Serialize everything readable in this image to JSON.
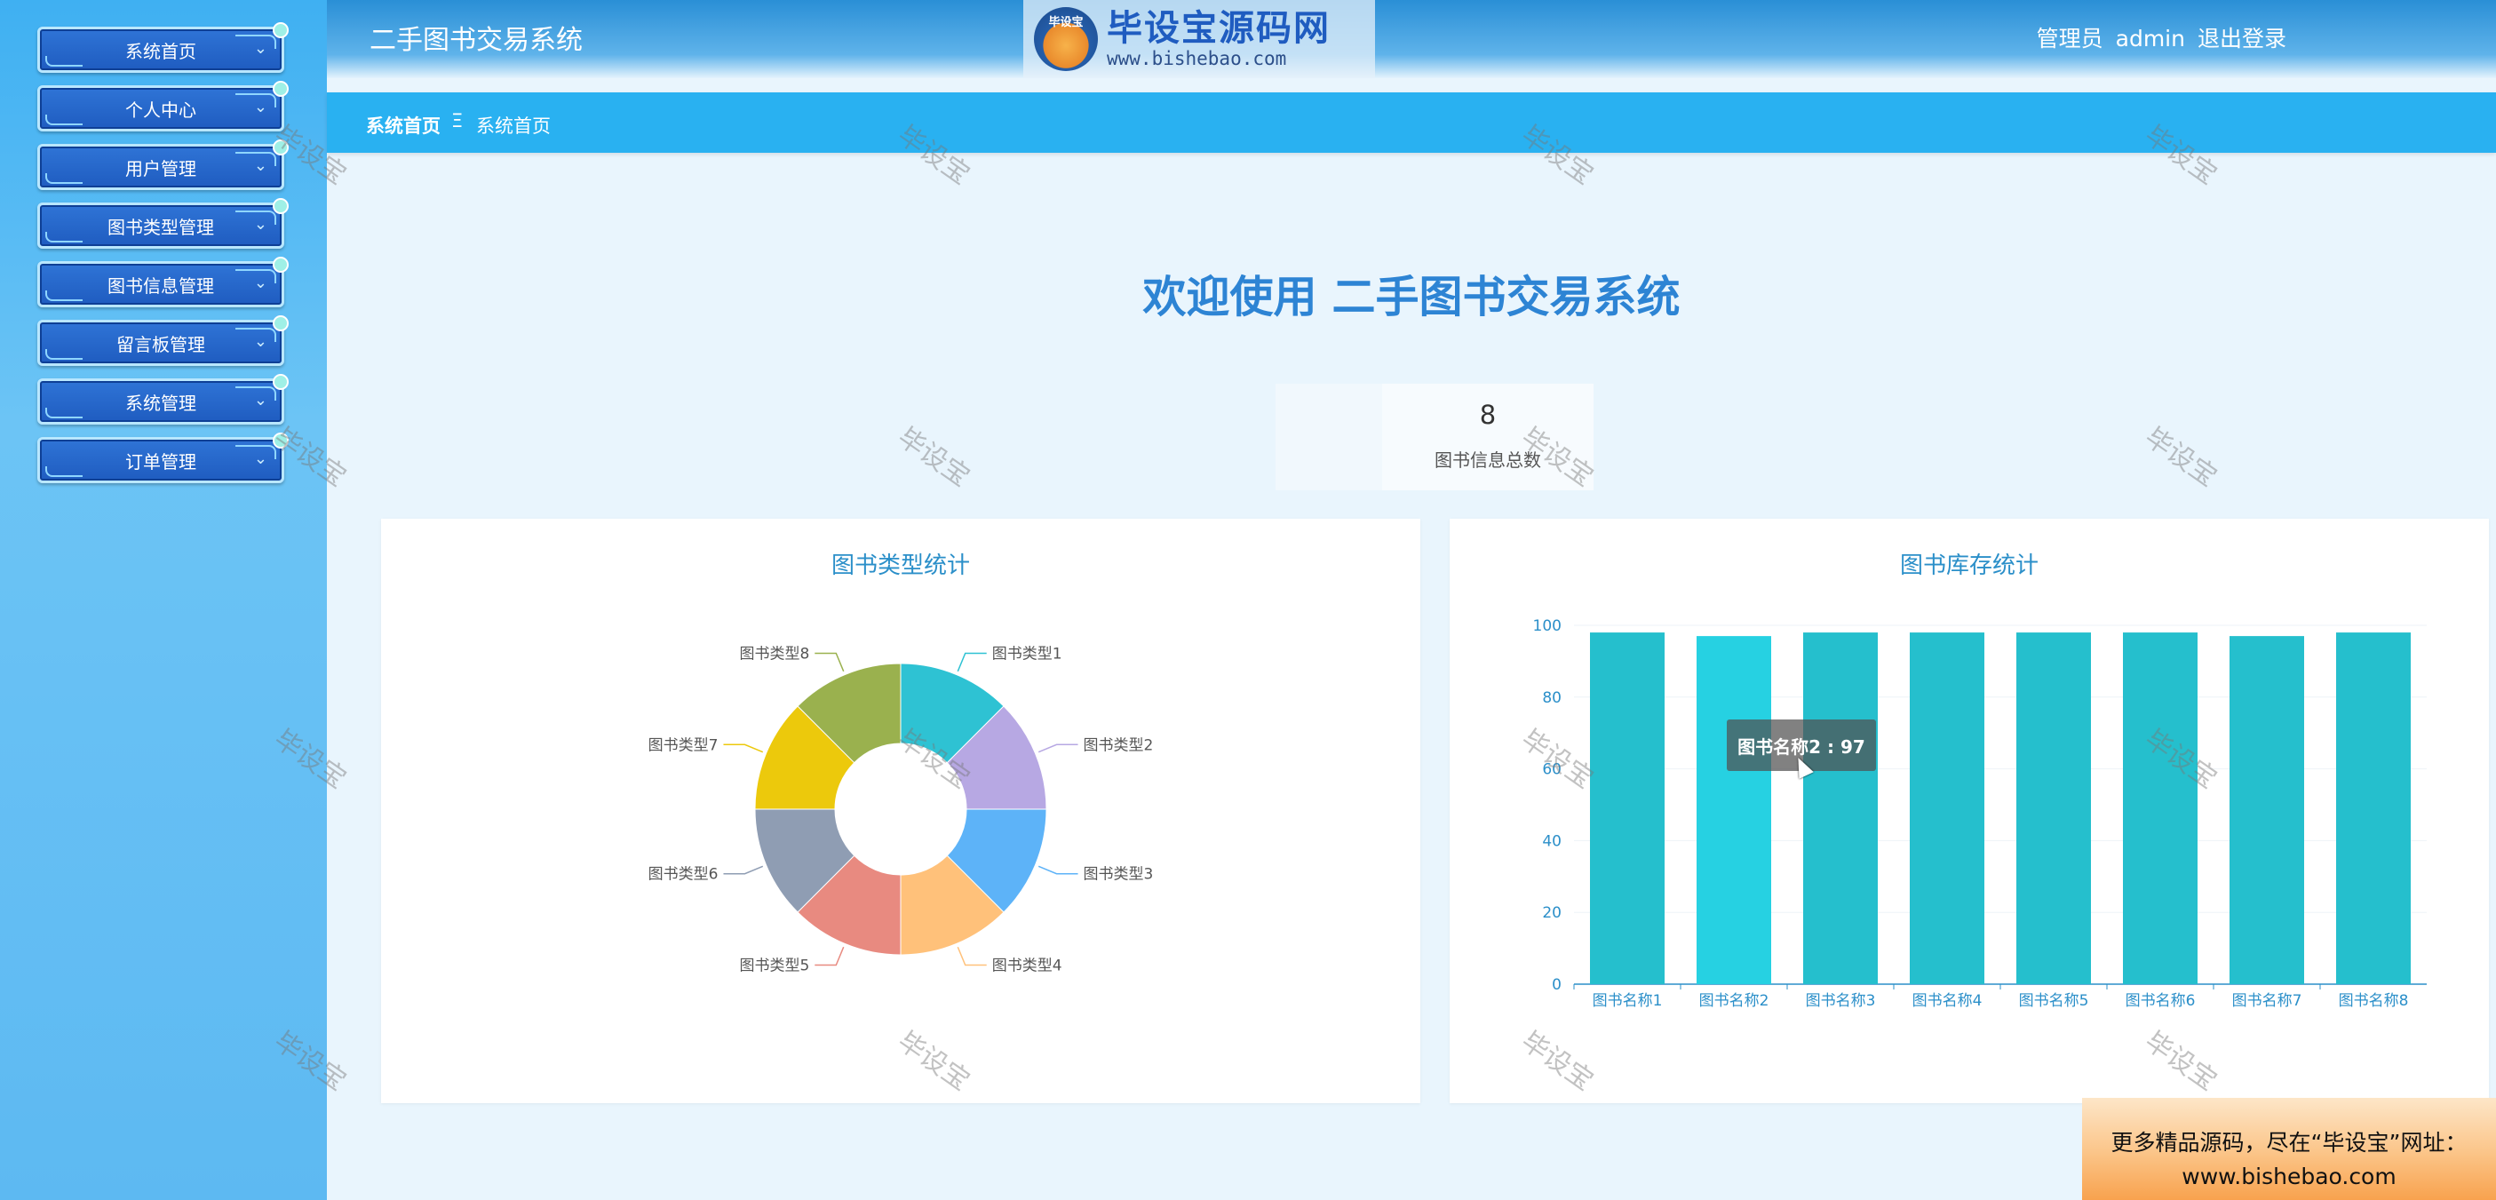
{
  "sidebar": {
    "items": [
      {
        "label": "系统首页"
      },
      {
        "label": "个人中心"
      },
      {
        "label": "用户管理"
      },
      {
        "label": "图书类型管理"
      },
      {
        "label": "图书信息管理"
      },
      {
        "label": "留言板管理"
      },
      {
        "label": "系统管理"
      },
      {
        "label": "订单管理"
      }
    ]
  },
  "header": {
    "title": "二手图书交易系统",
    "logo_badge": "毕设宝",
    "logo_main": "毕设宝源码网",
    "logo_url": "www.bishebao.com",
    "user_role": "管理员",
    "username": "admin",
    "logout_label": "退出登录"
  },
  "breadcrumb": {
    "root": "系统首页",
    "separator": "Ξ",
    "current": "系统首页"
  },
  "welcome": "欢迎使用 二手图书交易系统",
  "stat": {
    "value": "8",
    "label": "图书信息总数"
  },
  "pie_panel": {
    "title": "图书类型统计"
  },
  "bar_panel": {
    "title": "图书库存统计",
    "tooltip": "图书名称2 : 97"
  },
  "watermark": "毕设宝",
  "promo": {
    "line1": "更多精品源码，尽在“毕设宝”网址：",
    "line2": "www.bishebao.com"
  },
  "colors": {
    "sidebar": "#3fb0f2",
    "crumbbar": "#29b1f1",
    "accent": "#2d84d4",
    "bar": "#25bfcd"
  },
  "chart_data": [
    {
      "type": "pie",
      "title": "图书类型统计",
      "categories": [
        "图书类型1",
        "图书类型2",
        "图书类型3",
        "图书类型4",
        "图书类型5",
        "图书类型6",
        "图书类型7",
        "图书类型8"
      ],
      "values": [
        1,
        1,
        1,
        1,
        1,
        1,
        1,
        1
      ],
      "colors": [
        "#2ec2d3",
        "#b7a8e3",
        "#5db3f8",
        "#ffc17a",
        "#e88a80",
        "#8f9db3",
        "#ecc90c",
        "#9ab14e"
      ]
    },
    {
      "type": "bar",
      "title": "图书库存统计",
      "categories": [
        "图书名称1",
        "图书名称2",
        "图书名称3",
        "图书名称4",
        "图书名称5",
        "图书名称6",
        "图书名称7",
        "图书名称8"
      ],
      "values": [
        98,
        97,
        98,
        98,
        98,
        98,
        97,
        98
      ],
      "ylim": [
        0,
        100
      ],
      "yticks": [
        0,
        20,
        40,
        60,
        80,
        100
      ]
    }
  ]
}
